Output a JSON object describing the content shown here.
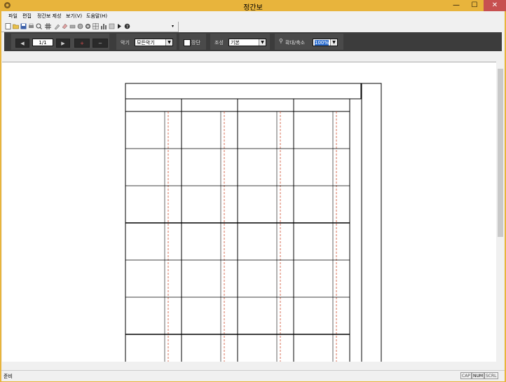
{
  "window": {
    "title": "정간보",
    "min": "—",
    "max": "☐",
    "close": "✕"
  },
  "menu": [
    "파일",
    "편집",
    "정간보 제성",
    "보기(V)",
    "도움말(H)"
  ],
  "toolbar_icons": [
    "new-icon",
    "open-icon",
    "save-icon",
    "print-icon",
    "preview-icon",
    "grid-icon",
    "brush-icon",
    "eraser-icon",
    "printer-icon",
    "globe-icon",
    "gear-icon",
    "table-icon",
    "chart-icon",
    "book-icon",
    "play-icon",
    "help-icon"
  ],
  "nav": {
    "page": "1/1",
    "prev": "◀",
    "next": "▶",
    "add_page": "+",
    "remove_page": "−"
  },
  "instrument": {
    "label": "악기",
    "value": "모든악기"
  },
  "jangdan": {
    "label": "장단"
  },
  "josung": {
    "label": "조성",
    "value": "기본"
  },
  "zoom": {
    "label": "확대/축소",
    "value": "100%"
  },
  "status": {
    "text": "준비",
    "cap": "CAP",
    "num": "NUM",
    "scrl": "SCRL"
  }
}
